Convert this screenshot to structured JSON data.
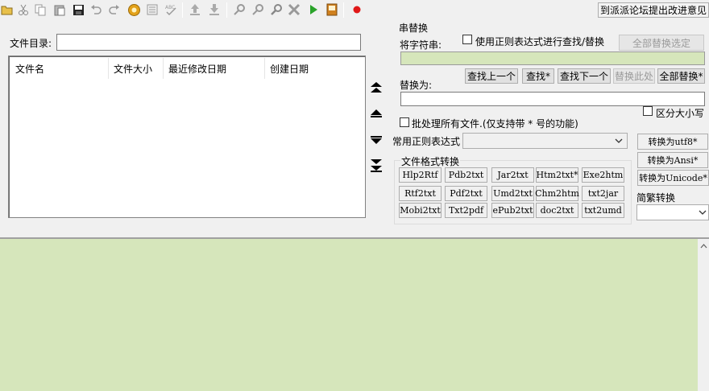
{
  "toolbar": {
    "icons": [
      "open-folder-icon",
      "cut-icon",
      "copy-icon",
      "paste-icon",
      "save-icon",
      "undo-icon",
      "redo-icon",
      "settings-gear-icon",
      "format-icon",
      "spellcheck-icon",
      "upload-icon",
      "download-icon",
      "search-icon",
      "find-icon",
      "replace-icon",
      "tools-icon",
      "run-icon",
      "book-icon",
      "record-icon"
    ],
    "feedback_label": "到派派论坛提出改进意见"
  },
  "file_dir": {
    "label": "文件目录:",
    "value": ""
  },
  "file_list": {
    "columns": [
      "文件名",
      "文件大小",
      "最近修改日期",
      "创建日期"
    ],
    "rows": []
  },
  "replace_panel": {
    "group_title": "串替换",
    "find_label": "将字符串:",
    "regex_label": "使用正则表达式进行查找/替换",
    "replace_all_selected": "全部替换选定",
    "find_value": "",
    "find_prev": "查找上一个",
    "find_star": "查找*",
    "find_next": "查找下一个",
    "replace_here": "替换此处",
    "replace_all_star": "全部替换*",
    "replace_label": "替换为:",
    "replace_value": "",
    "case_label": "区分大小写"
  },
  "batch_label": "批处理所有文件.(仅支持带 * 号的功能)",
  "common_regex": {
    "label": "常用正则表达式",
    "selected": ""
  },
  "format_convert": {
    "group_title": "文件格式转换",
    "buttons": [
      "Hlp2Rtf",
      "Pdb2txt",
      "Jar2txt",
      "Htm2txt*",
      "Exe2htm",
      "Rtf2txt",
      "Pdf2txt",
      "Umd2txt",
      "Chm2htm",
      "txt2jar",
      "Mobi2txt",
      "Txt2pdf",
      "ePub2txt",
      "doc2txt",
      "txt2umd"
    ]
  },
  "encoding": {
    "to_utf8": "转换为utf8*",
    "to_ansi": "转换为Ansi*",
    "to_unicode": "转换为Unicode*"
  },
  "simp_trad": {
    "label": "简繁转换",
    "selected": ""
  },
  "colors": {
    "green_pane": "#d6e6bb",
    "panel": "#f0f0f0"
  }
}
